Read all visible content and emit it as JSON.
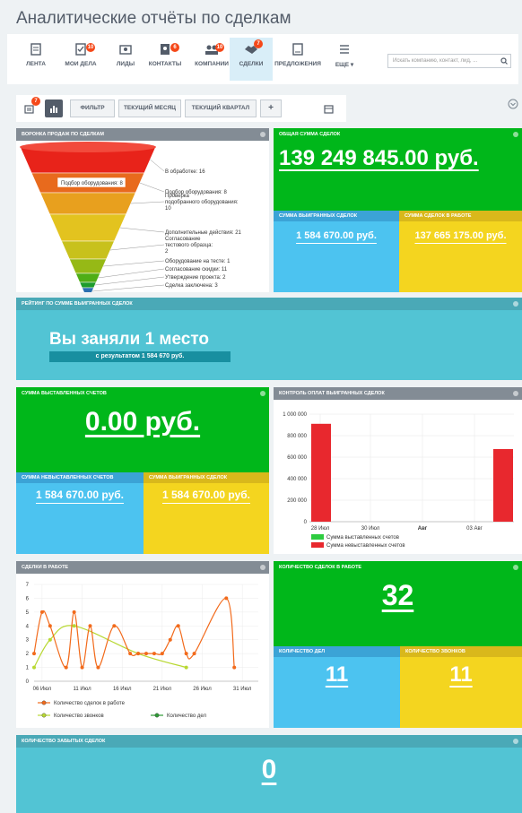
{
  "title": "Аналитические отчёты по сделкам",
  "nav": {
    "items": [
      {
        "label": "ЛЕНТА",
        "badge": null
      },
      {
        "label": "МОИ ДЕЛА",
        "badge": "10"
      },
      {
        "label": "ЛИДЫ",
        "badge": null
      },
      {
        "label": "КОНТАКТЫ",
        "badge": "6"
      },
      {
        "label": "КОМПАНИИ",
        "badge": "10"
      },
      {
        "label": "СДЕЛКИ",
        "badge": "7"
      },
      {
        "label": "ПРЕДЛОЖЕНИЯ",
        "badge": null
      },
      {
        "label": "ЕЩЕ ▾",
        "badge": null
      }
    ],
    "search_placeholder": "Искать компанию, контакт, лид, ..."
  },
  "toolbar": {
    "list_badge": "7",
    "filter": "ФИЛЬТР",
    "current_month": "ТЕКУЩИЙ МЕСЯЦ",
    "current_quarter": "ТЕКУЩИЙ КВАРТАЛ",
    "add": "+"
  },
  "funnel": {
    "title": "ВОРОНКА ПРОДАЖ ПО СДЕЛКАМ",
    "tooltip": "Подбор оборудования: 8",
    "stages": [
      {
        "label": "В обработке: 16",
        "color": "#e8231a"
      },
      {
        "label": "Подбор оборудования: 8",
        "color": "#e86a1d"
      },
      {
        "label": "Проверка подобранного оборудования: 10",
        "color": "#e8a01e"
      },
      {
        "label": "Дополнительные действия: 21",
        "color": "#e3c31f"
      },
      {
        "label": "Согласование тестового образца: 2",
        "color": "#c8c11c"
      },
      {
        "label": "Оборудование на тесте: 1",
        "color": "#96b916"
      },
      {
        "label": "Согласование скидки: 11",
        "color": "#4fae16"
      },
      {
        "label": "Утверждение проекта: 2",
        "color": "#1d9c2c"
      },
      {
        "label": "Сделка заключена: 3",
        "color": "#2a6fb0"
      }
    ]
  },
  "total": {
    "title": "ОБЩАЯ СУММА СДЕЛОК",
    "value": "139 249 845.00 руб.",
    "won_title": "СУММА ВЫИГРАННЫХ СДЕЛОК",
    "won_value": "1 584 670.00 руб.",
    "work_title": "СУММА СДЕЛОК В РАБОТЕ",
    "work_value": "137 665 175.00 руб."
  },
  "rating": {
    "title": "РЕЙТИНГ ПО СУММЕ ВЫИГРАННЫХ СДЕЛОК",
    "place": "Вы заняли 1 место",
    "result": "с результатом 1 584 670 руб."
  },
  "invoices": {
    "title": "СУММА ВЫСТАВЛЕННЫХ СЧЕТОВ",
    "value": "0.00 руб.",
    "unbilled_title": "СУММА НЕВЫСТАВЛЕННЫХ СЧЕТОВ",
    "unbilled_value": "1 584 670.00 руб.",
    "won_title": "СУММА ВЫИГРАННЫХ СДЕЛОК",
    "won_value": "1 584 670.00 руб."
  },
  "payments_chart": {
    "title": "КОНТРОЛЬ ОПЛАТ ВЫИГРАННЫХ СДЕЛОК",
    "legend_billed": "Сумма выставленных счетов",
    "legend_unbilled": "Сумма невыставленных счетов",
    "color_billed": "#2ecc40",
    "color_unbilled": "#e8282e"
  },
  "deals_chart": {
    "title": "СДЕЛКИ В РАБОТЕ",
    "legend_deals": "Количество сделок в работе",
    "legend_calls": "Количество звонков",
    "legend_tasks": "Количество дел",
    "color_deals": "#f26a1b",
    "color_calls": "#b8d832"
  },
  "in_work": {
    "title": "КОЛИЧЕСТВО СДЕЛОК В РАБОТЕ",
    "value": "32",
    "tasks_title": "КОЛИЧЕСТВО ДЕЛ",
    "tasks_value": "11",
    "calls_title": "КОЛИЧЕСТВО ЗВОНКОВ",
    "calls_value": "11"
  },
  "forgotten": {
    "title": "КОЛИЧЕСТВО ЗАБЫТЫХ СДЕЛОК",
    "value": "0"
  },
  "chart_data": [
    {
      "type": "bar",
      "title": "КОНТРОЛЬ ОПЛАТ ВЫИГРАННЫХ СДЕЛОК",
      "x_ticks": [
        "28 Июл",
        "30 Июл",
        "Авг",
        "03 Авг"
      ],
      "y_ticks": [
        "0",
        "200 000",
        "400 000",
        "600 000",
        "800 000",
        "1 000 000"
      ],
      "ylim": [
        0,
        1000000
      ],
      "series": [
        {
          "name": "Сумма выставленных счетов",
          "points": []
        },
        {
          "name": "Сумма невыставленных счетов",
          "points": [
            {
              "x": "28 Июл",
              "y": 910000
            },
            {
              "x": "04 Авг",
              "y": 675000
            }
          ]
        }
      ],
      "legend": "bottom-left",
      "grid": true
    },
    {
      "type": "line",
      "title": "СДЕЛКИ В РАБОТЕ",
      "x_ticks": [
        "06 Июл",
        "11 Июл",
        "16 Июл",
        "21 Июл",
        "26 Июл",
        "31 Июл"
      ],
      "y_ticks": [
        "0",
        "1",
        "2",
        "3",
        "4",
        "5",
        "6",
        "7"
      ],
      "ylim": [
        0,
        7
      ],
      "x_start_day": 5,
      "series": [
        {
          "name": "Количество сделок в работе",
          "x": [
            5,
            6,
            7,
            9,
            10,
            11,
            12,
            13,
            15,
            17,
            18,
            19,
            20,
            21,
            22,
            23,
            24,
            25,
            29,
            30
          ],
          "y": [
            2,
            5,
            4,
            1,
            5,
            1,
            4,
            1,
            4,
            2,
            2,
            2,
            2,
            2,
            3,
            4,
            2,
            2,
            6,
            1
          ]
        },
        {
          "name": "Количество звонков",
          "x": [
            5,
            7,
            10,
            18,
            24
          ],
          "y": [
            1,
            3,
            4,
            2,
            1
          ]
        },
        {
          "name": "Количество дел",
          "x": [],
          "y": []
        }
      ],
      "legend": "bottom",
      "grid": true
    }
  ]
}
